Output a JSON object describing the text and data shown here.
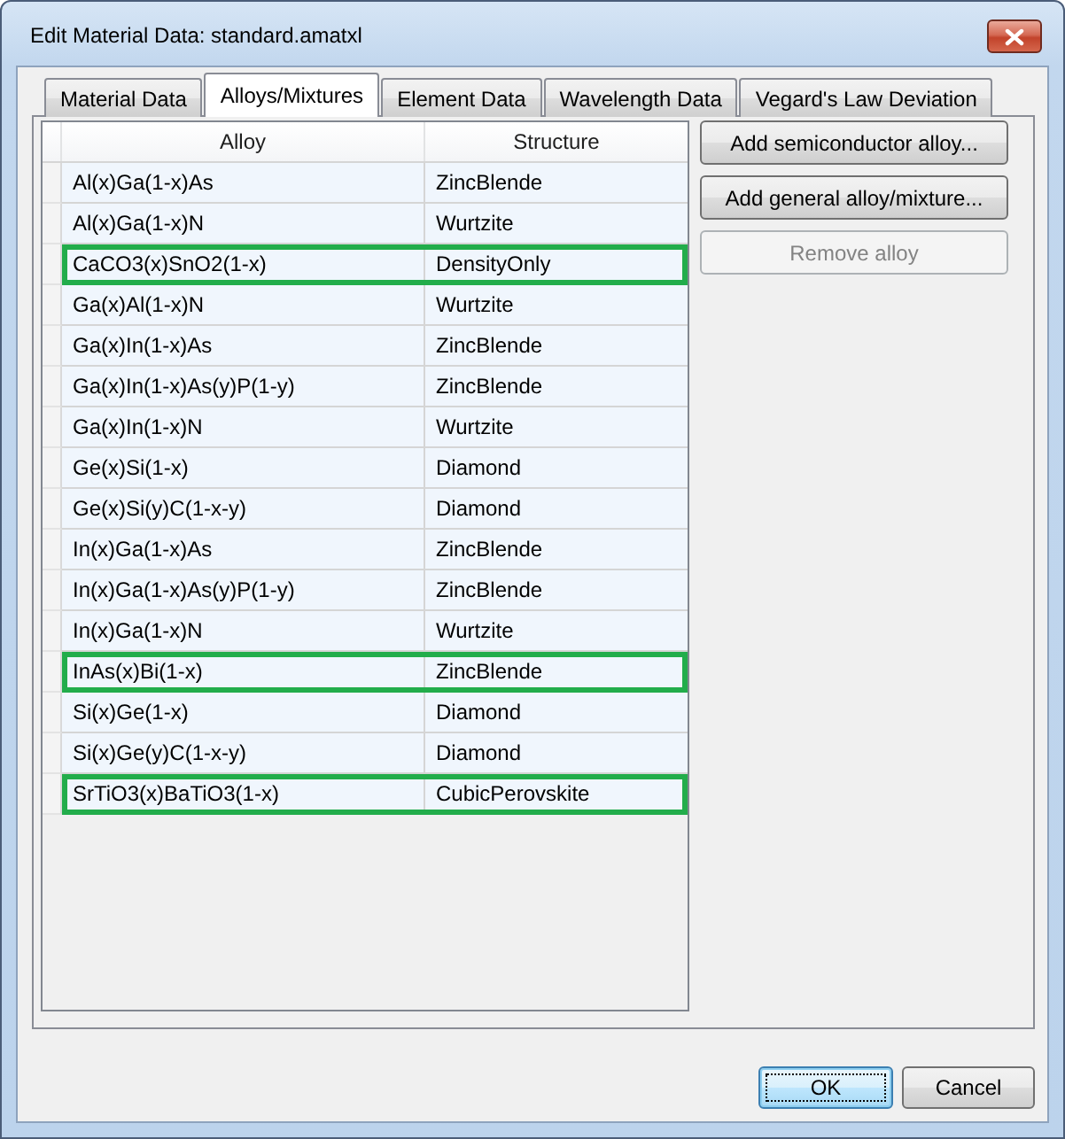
{
  "window": {
    "title": "Edit Material Data: standard.amatxl"
  },
  "tabs": [
    {
      "label": "Material Data",
      "selected": false
    },
    {
      "label": "Alloys/Mixtures",
      "selected": true
    },
    {
      "label": "Element Data",
      "selected": false
    },
    {
      "label": "Wavelength Data",
      "selected": false
    },
    {
      "label": "Vegard's Law Deviation",
      "selected": false
    }
  ],
  "table": {
    "columns": [
      "Alloy",
      "Structure"
    ],
    "rows": [
      {
        "cells": [
          "Al(x)Ga(1-x)As",
          "ZincBlende"
        ],
        "highlighted": false
      },
      {
        "cells": [
          "Al(x)Ga(1-x)N",
          "Wurtzite"
        ],
        "highlighted": false
      },
      {
        "cells": [
          "CaCO3(x)SnO2(1-x)",
          "DensityOnly"
        ],
        "highlighted": true
      },
      {
        "cells": [
          "Ga(x)Al(1-x)N",
          "Wurtzite"
        ],
        "highlighted": false
      },
      {
        "cells": [
          "Ga(x)In(1-x)As",
          "ZincBlende"
        ],
        "highlighted": false
      },
      {
        "cells": [
          "Ga(x)In(1-x)As(y)P(1-y)",
          "ZincBlende"
        ],
        "highlighted": false
      },
      {
        "cells": [
          "Ga(x)In(1-x)N",
          "Wurtzite"
        ],
        "highlighted": false
      },
      {
        "cells": [
          "Ge(x)Si(1-x)",
          "Diamond"
        ],
        "highlighted": false
      },
      {
        "cells": [
          "Ge(x)Si(y)C(1-x-y)",
          "Diamond"
        ],
        "highlighted": false
      },
      {
        "cells": [
          "In(x)Ga(1-x)As",
          "ZincBlende"
        ],
        "highlighted": false
      },
      {
        "cells": [
          "In(x)Ga(1-x)As(y)P(1-y)",
          "ZincBlende"
        ],
        "highlighted": false
      },
      {
        "cells": [
          "In(x)Ga(1-x)N",
          "Wurtzite"
        ],
        "highlighted": false
      },
      {
        "cells": [
          "InAs(x)Bi(1-x)",
          "ZincBlende"
        ],
        "highlighted": true
      },
      {
        "cells": [
          "Si(x)Ge(1-x)",
          "Diamond"
        ],
        "highlighted": false
      },
      {
        "cells": [
          "Si(x)Ge(y)C(1-x-y)",
          "Diamond"
        ],
        "highlighted": false
      },
      {
        "cells": [
          "SrTiO3(x)BaTiO3(1-x)",
          "CubicPerovskite"
        ],
        "highlighted": true
      }
    ]
  },
  "buttons": [
    {
      "label": "Add semiconductor alloy...",
      "disabled": false
    },
    {
      "label": "Add general alloy/mixture...",
      "disabled": false
    },
    {
      "label": "Remove alloy",
      "disabled": true
    }
  ],
  "dialog_buttons": [
    {
      "label": "OK",
      "default": true
    },
    {
      "label": "Cancel",
      "default": false
    }
  ]
}
